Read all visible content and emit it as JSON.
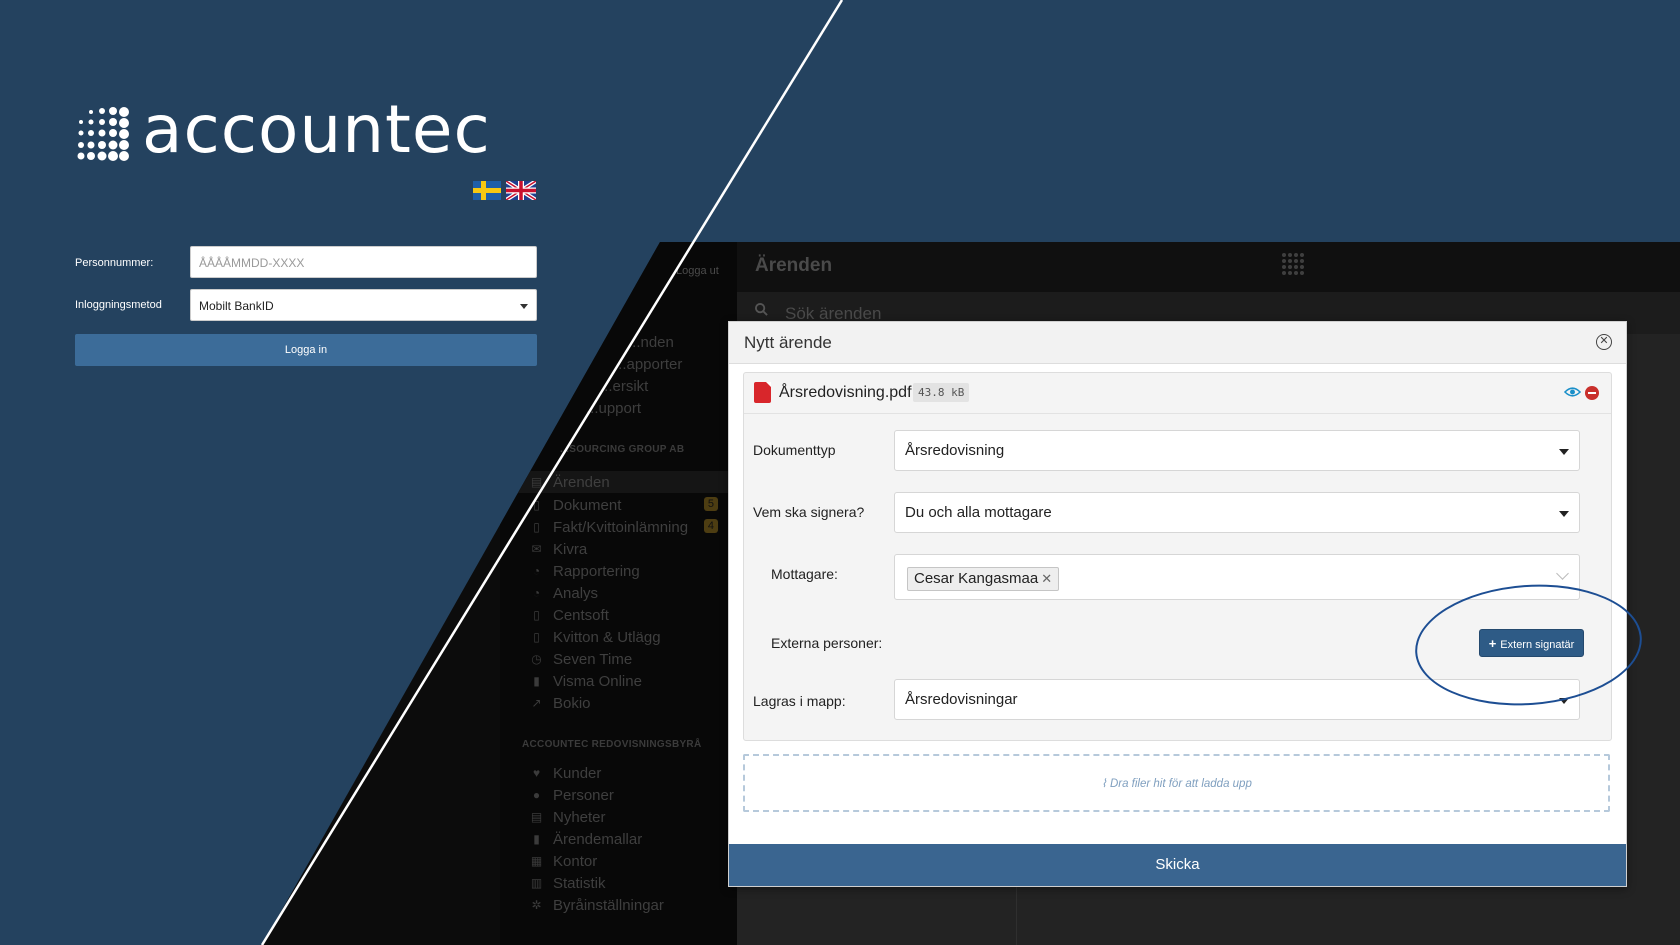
{
  "login": {
    "brand": "accountec",
    "languages": [
      "sv-flag-icon",
      "uk-flag-icon"
    ],
    "personnummer_label": "Personnummer:",
    "personnummer_placeholder": "ÅÅÅÅMMDD-XXXX",
    "method_label": "Inloggningsmetod",
    "method_value": "Mobilt BankID",
    "login_button": "Logga in"
  },
  "app": {
    "title": "Ärenden",
    "logout": "Logga ut",
    "search_placeholder": "Sök ärenden",
    "sidebar_top": [
      "...nden",
      "...apporter",
      "...ersikt",
      "...upport"
    ],
    "group1": "...SOURCING GROUP AB",
    "group1_items": [
      {
        "label": "Ärenden",
        "icon": "cases-icon",
        "badge": ""
      },
      {
        "label": "Dokument",
        "icon": "document-icon",
        "badge": "5"
      },
      {
        "label": "Fakt/Kvittoinlämning",
        "icon": "file-icon",
        "badge": "4"
      },
      {
        "label": "Kivra",
        "icon": "mail-icon",
        "badge": ""
      },
      {
        "label": "Rapportering",
        "icon": "pie-chart-icon",
        "badge": ""
      },
      {
        "label": "Analys",
        "icon": "pie-chart-icon",
        "badge": ""
      },
      {
        "label": "Centsoft",
        "icon": "file-icon",
        "badge": ""
      },
      {
        "label": "Kvitton & Utlägg",
        "icon": "file-icon",
        "badge": ""
      },
      {
        "label": "Seven Time",
        "icon": "clock-icon",
        "badge": ""
      },
      {
        "label": "Visma Online",
        "icon": "book-icon",
        "badge": ""
      },
      {
        "label": "Bokio",
        "icon": "external-link-icon",
        "badge": ""
      }
    ],
    "group2": "ACCOUNTEC REDOVISNINGSBYRÅ",
    "group2_items": [
      {
        "label": "Kunder",
        "icon": "heart-icon"
      },
      {
        "label": "Personer",
        "icon": "user-icon"
      },
      {
        "label": "Nyheter",
        "icon": "news-icon"
      },
      {
        "label": "Ärendemallar",
        "icon": "bookmark-icon"
      },
      {
        "label": "Kontor",
        "icon": "building-icon"
      },
      {
        "label": "Statistik",
        "icon": "bar-chart-icon"
      },
      {
        "label": "Byråinställningar",
        "icon": "gear-icon"
      }
    ]
  },
  "modal": {
    "title": "Nytt ärende",
    "file_name": "Årsredovisning.pdf",
    "file_size": "43.8 kB",
    "doc_type_label": "Dokumenttyp",
    "doc_type_value": "Årsredovisning",
    "signer_label": "Vem ska signera?",
    "signer_value": "Du och alla mottagare",
    "recipient_label": "Mottagare:",
    "recipient_tag": "Cesar Kangasmaa",
    "external_label": "Externa personer:",
    "external_button": "Extern signatär",
    "folder_label": "Lagras i mapp:",
    "folder_value": "Årsredovisningar",
    "drop_text": "Dra filer hit för att ladda upp",
    "send_button": "Skicka"
  }
}
